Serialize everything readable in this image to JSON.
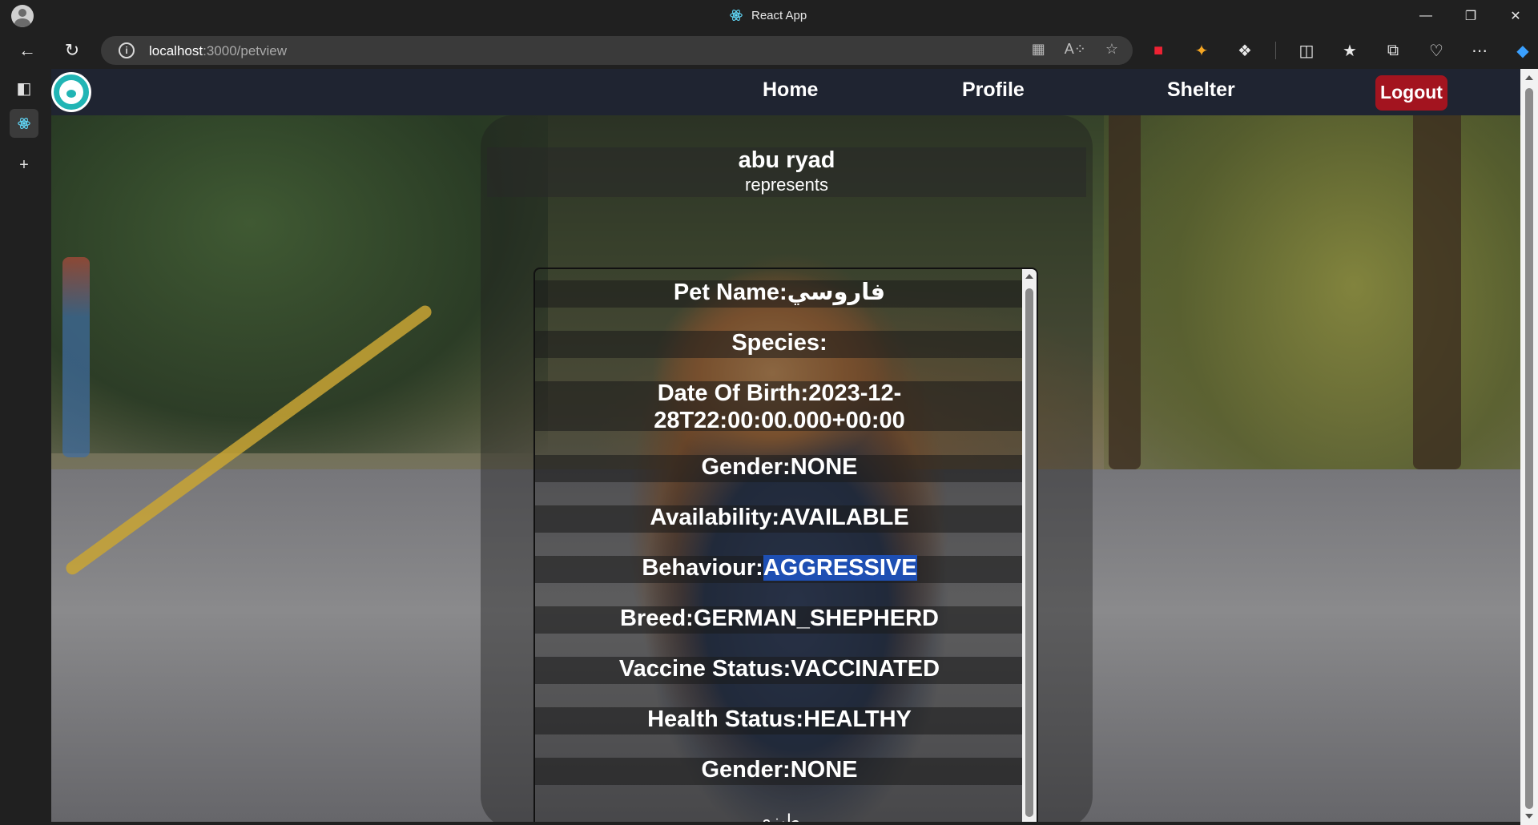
{
  "browser": {
    "tab_title": "React App",
    "url_host": "localhost",
    "url_path": ":3000/petview",
    "window_controls": [
      "minimize-icon",
      "restore-icon",
      "close-icon"
    ],
    "toolbar_icons": [
      "collections-icon",
      "read-aloud-icon",
      "favorite-star-icon",
      "extension-1-icon",
      "extension-2-icon",
      "extensions-icon",
      "split-screen-icon",
      "favorites-icon",
      "collections-icon",
      "performance-icon",
      "more-icon",
      "copilot-icon"
    ]
  },
  "app_nav": {
    "links": [
      "Home",
      "Profile",
      "Shelter"
    ],
    "logout_label": "Logout",
    "logout_color": "#a3141f"
  },
  "card": {
    "owner_name": "abu ryad",
    "subtitle": "represents"
  },
  "pet": {
    "rows": [
      {
        "label": "Pet Name:",
        "value": "فاروسي"
      },
      {
        "label": "Species:",
        "value": ""
      },
      {
        "label": "Date Of Birth:",
        "value": "2023-12-28T22:00:00.000+00:00"
      },
      {
        "label": "Gender:",
        "value": "NONE"
      },
      {
        "label": "Availability:",
        "value": "AVAILABLE"
      },
      {
        "label": "Behaviour:",
        "value": "AGGRESSIVE"
      },
      {
        "label": "Breed:",
        "value": "GERMAN_SHEPHERD"
      },
      {
        "label": "Vaccine Status:",
        "value": "VACCINATED"
      },
      {
        "label": "Health Status:",
        "value": "HEALTHY"
      },
      {
        "label": "Gender:",
        "value": "NONE"
      }
    ],
    "extra_text": "طيزي"
  }
}
